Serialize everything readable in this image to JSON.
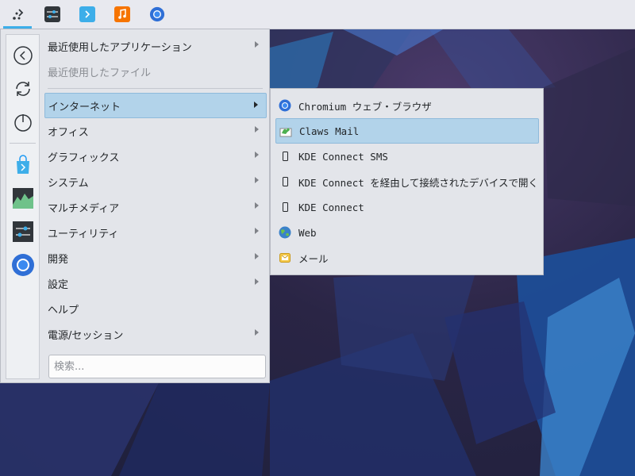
{
  "taskbar": {
    "buttons": [
      {
        "name": "application-launcher",
        "icon": "kde-launcher-icon"
      },
      {
        "name": "system-settings",
        "icon": "sliders-icon"
      },
      {
        "name": "discover",
        "icon": "store-bag-icon"
      },
      {
        "name": "music",
        "icon": "music-note-icon"
      },
      {
        "name": "chromium",
        "icon": "chromium-icon"
      }
    ]
  },
  "menu": {
    "favorites": [
      "back-icon",
      "refresh-icon",
      "power-icon",
      "discover-icon",
      "system-monitor-icon",
      "system-settings-icon",
      "chromium-icon"
    ],
    "items": [
      {
        "label": "最近使用したアプリケーション",
        "has_submenu": true
      },
      {
        "label": "最近使用したファイル",
        "disabled": true
      },
      {
        "label": "インターネット",
        "has_submenu": true,
        "highlighted": true
      },
      {
        "label": "オフィス",
        "has_submenu": true
      },
      {
        "label": "グラフィックス",
        "has_submenu": true
      },
      {
        "label": "システム",
        "has_submenu": true
      },
      {
        "label": "マルチメディア",
        "has_submenu": true
      },
      {
        "label": "ユーティリティ",
        "has_submenu": true
      },
      {
        "label": "開発",
        "has_submenu": true
      },
      {
        "label": "設定",
        "has_submenu": true
      },
      {
        "label": "ヘルプ"
      },
      {
        "label": "電源/セッション",
        "has_submenu": true
      }
    ],
    "search": {
      "placeholder": "検索...",
      "value": ""
    }
  },
  "submenu": {
    "items": [
      {
        "label": "Chromium ウェブ・ブラウザ",
        "icon": "chromium-icon"
      },
      {
        "label": "Claws Mail",
        "icon": "claws-mail-icon",
        "highlighted": true
      },
      {
        "label": "KDE Connect SMS",
        "icon": "phone-icon"
      },
      {
        "label": "KDE Connect を経由して接続されたデバイスで開く",
        "icon": "phone-icon"
      },
      {
        "label": "KDE Connect",
        "icon": "phone-icon"
      },
      {
        "label": "Web",
        "icon": "globe-icon"
      },
      {
        "label": "メール",
        "icon": "mail-icon"
      }
    ]
  },
  "colors": {
    "highlight": "#b2d3ea",
    "accent": "#3daee9",
    "menu_bg": "#e3e5ea"
  }
}
